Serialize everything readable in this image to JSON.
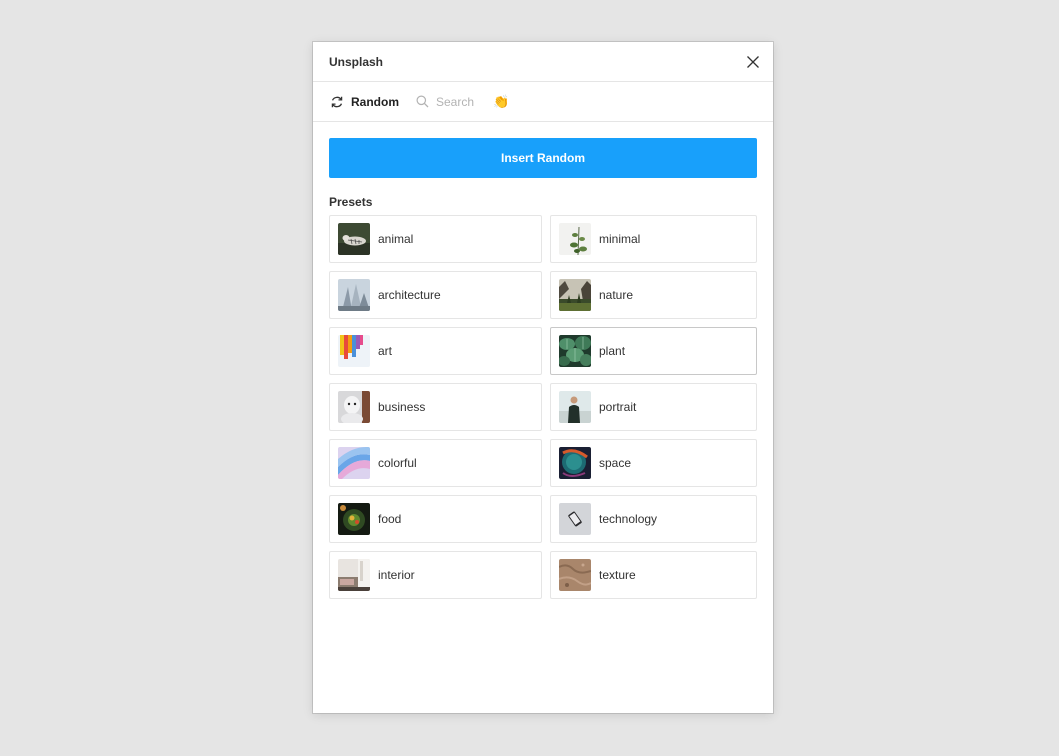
{
  "window": {
    "title": "Unsplash",
    "close_icon": "close-icon"
  },
  "tabs": {
    "random": {
      "label": "Random",
      "icon": "refresh-icon"
    },
    "search": {
      "placeholder": "Search",
      "icon": "search-icon"
    },
    "emoji": {
      "glyph": "👏",
      "icon": "clapping-hands-icon"
    }
  },
  "insert_button": {
    "label": "Insert Random",
    "color": "#18a0fb"
  },
  "presets": {
    "heading": "Presets",
    "items": [
      {
        "label": "animal"
      },
      {
        "label": "minimal"
      },
      {
        "label": "architecture"
      },
      {
        "label": "nature"
      },
      {
        "label": "art"
      },
      {
        "label": "plant"
      },
      {
        "label": "business"
      },
      {
        "label": "portrait"
      },
      {
        "label": "colorful"
      },
      {
        "label": "space"
      },
      {
        "label": "food"
      },
      {
        "label": "technology"
      },
      {
        "label": "interior"
      },
      {
        "label": "texture"
      }
    ]
  }
}
